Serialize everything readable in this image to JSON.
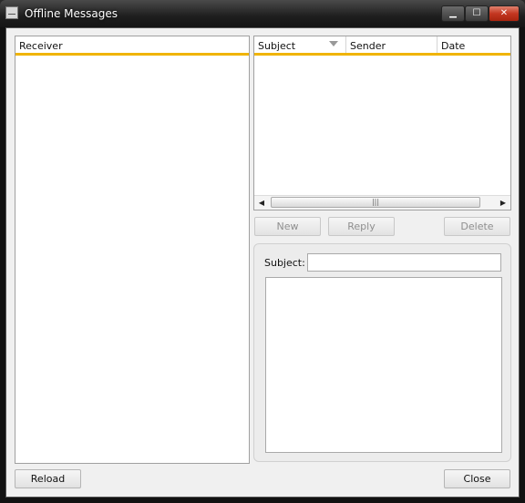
{
  "window": {
    "title": "Offline Messages",
    "controls": {
      "minimize": "▁",
      "maximize": "☐",
      "close": "✕"
    },
    "accent_color": "#f0b400",
    "close_color": "#c33620"
  },
  "receiver_list": {
    "header": "Receiver"
  },
  "messages_table": {
    "columns": [
      "Subject",
      "Sender",
      "Date"
    ],
    "sort_icon": "sort-descending-icon",
    "scroll_left": "◀",
    "scroll_right": "▶",
    "thumb_grip": "|||"
  },
  "actions": {
    "new_label": "New",
    "reply_label": "Reply",
    "delete_label": "Delete"
  },
  "compose": {
    "subject_label": "Subject:",
    "subject_value": "",
    "body_value": ""
  },
  "footer": {
    "reload_label": "Reload",
    "close_label": "Close"
  }
}
